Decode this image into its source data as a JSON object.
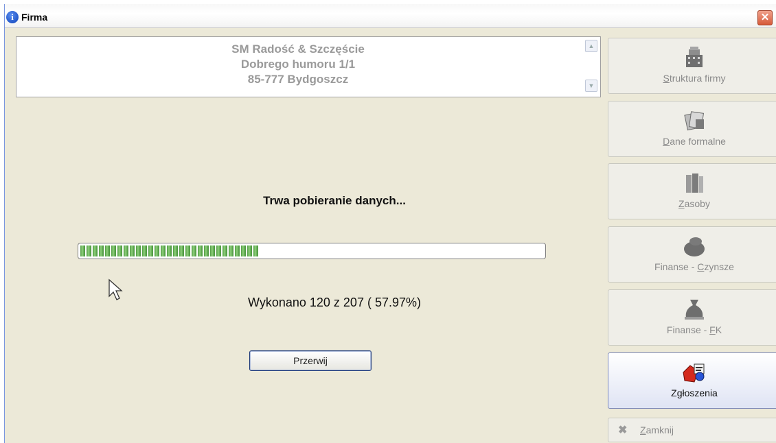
{
  "window": {
    "title": "Firma",
    "close_glyph": "✕"
  },
  "address": {
    "lines": [
      "SM Radość & Szczęście",
      "Dobrego humoru 1/1",
      "85-777 Bydgoszcz"
    ]
  },
  "progress": {
    "status_text": "Trwa pobieranie danych...",
    "done_text": "Wykonano 120 z 207 ( 57.97%)",
    "fraction": 0.5797,
    "abort_label": "Przerwij"
  },
  "nav": {
    "items": [
      {
        "key": "S",
        "rest": "truktura firmy",
        "prefix": "",
        "icon": "building-icon"
      },
      {
        "key": "D",
        "rest": "ane formalne",
        "prefix": "",
        "icon": "documents-icon"
      },
      {
        "key": "Z",
        "rest": "asoby",
        "prefix": "",
        "icon": "binders-icon"
      },
      {
        "key": "C",
        "rest": "zynsze",
        "prefix": "Finanse - ",
        "icon": "money-bag-icon"
      },
      {
        "key": "F",
        "rest": "K",
        "prefix": "Finanse - ",
        "icon": "money-sack-icon"
      },
      {
        "key": "",
        "rest": "Zgłoszenia",
        "prefix": "",
        "icon": "reports-icon"
      }
    ],
    "close": {
      "key": "Z",
      "rest": "amknij",
      "icon": "close-x-icon"
    }
  },
  "colors": {
    "progress_green": "#4f9a42",
    "title_blue": "#0a3fb8"
  }
}
